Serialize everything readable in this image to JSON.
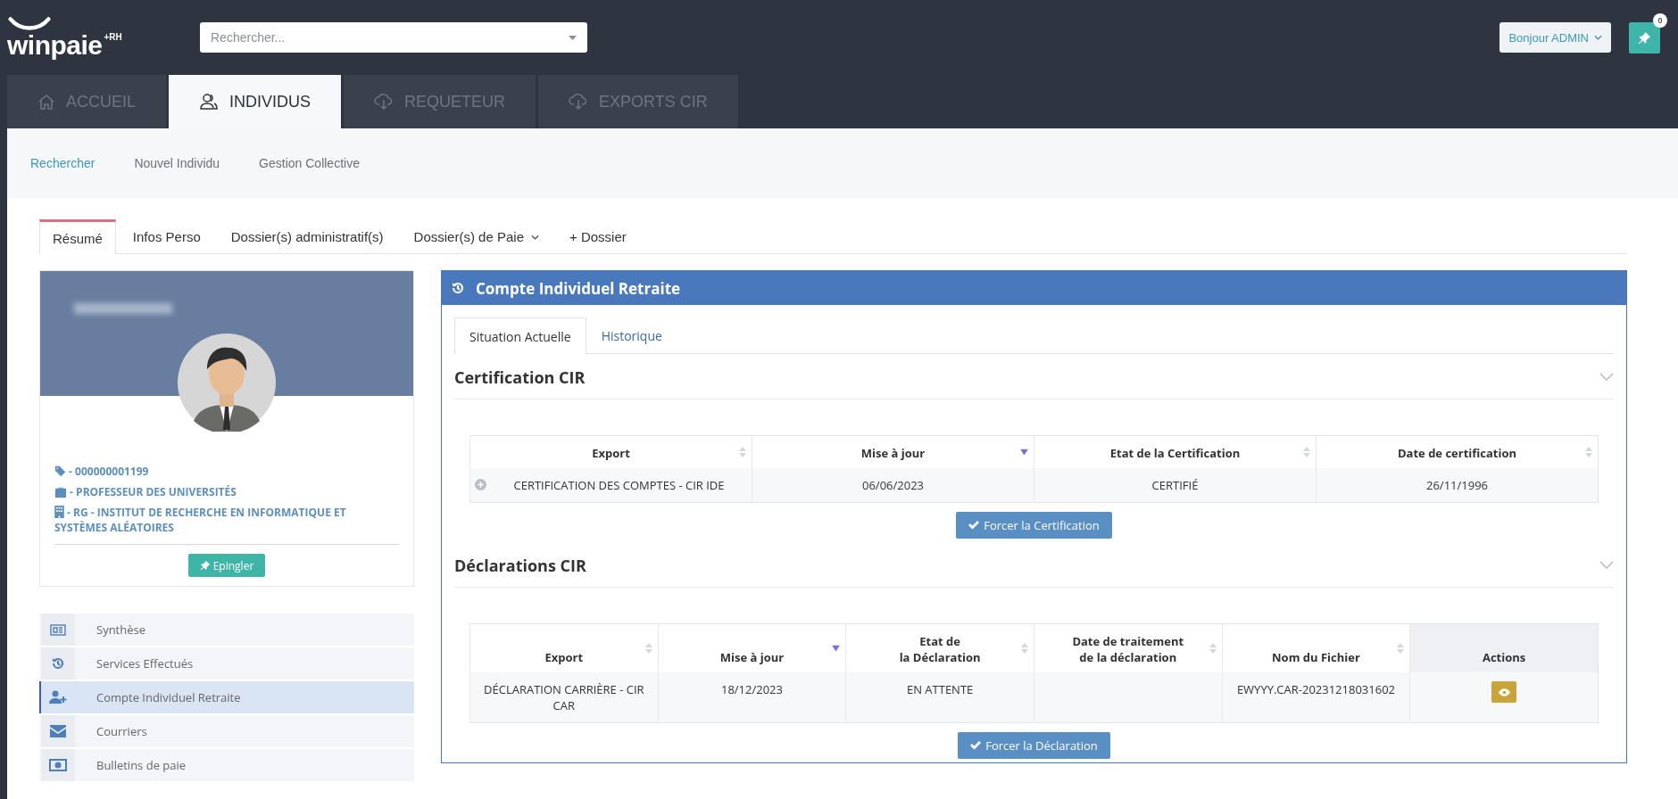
{
  "header": {
    "logo": "winpaie",
    "logo_suffix": "+RH",
    "search": {
      "placeholder": "Rechercher..."
    },
    "user_menu": "Bonjour ADMIN",
    "pin_count": "0"
  },
  "main_tabs": [
    {
      "label": "ACCUEIL",
      "selected": false
    },
    {
      "label": "INDIVIDUS",
      "selected": true
    },
    {
      "label": "REQUETEUR",
      "selected": false
    },
    {
      "label": "EXPORTS CIR",
      "selected": false
    }
  ],
  "sub_nav": [
    {
      "label": "Rechercher",
      "selected": true
    },
    {
      "label": "Nouvel Individu",
      "selected": false
    },
    {
      "label": "Gestion Collective",
      "selected": false
    }
  ],
  "content_tabs": [
    {
      "label": "Résumé",
      "selected": true,
      "dropdown": false
    },
    {
      "label": "Infos Perso",
      "selected": false,
      "dropdown": false
    },
    {
      "label": "Dossier(s) administratif(s)",
      "selected": false,
      "dropdown": false
    },
    {
      "label": "Dossier(s) de Paie",
      "selected": false,
      "dropdown": true
    },
    {
      "label": "+ Dossier",
      "selected": false,
      "dropdown": false
    }
  ],
  "profile": {
    "info": [
      "- 000000001199",
      "- PROFESSEUR DES UNIVERSITÉS",
      "- RG - INSTITUT DE RECHERCHE EN INFORMATIQUE ET SYSTÈMES ALÉATOIRES"
    ],
    "pin_button": "Epingler"
  },
  "side_menu": [
    {
      "label": "Synthèse",
      "selected": false
    },
    {
      "label": "Services Effectués",
      "selected": false
    },
    {
      "label": "Compte Individuel Retraite",
      "selected": true
    },
    {
      "label": "Courriers",
      "selected": false
    },
    {
      "label": "Bulletins de paie",
      "selected": false
    }
  ],
  "panel": {
    "title": "Compte Individuel Retraite",
    "tabs": [
      {
        "label": "Situation Actuelle",
        "selected": true
      },
      {
        "label": "Historique",
        "selected": false
      }
    ],
    "sections": [
      {
        "title": "Certification CIR",
        "columns": [
          {
            "label": "Export",
            "sortable": true,
            "sorted": false
          },
          {
            "label": "Mise à jour",
            "sortable": true,
            "sorted": true
          },
          {
            "label": "Etat de la Certification",
            "sortable": true,
            "sorted": false
          },
          {
            "label": "Date de certification",
            "sortable": true,
            "sorted": false
          }
        ],
        "rows": [
          {
            "expandable": true,
            "cells": [
              "CERTIFICATION DES COMPTES - CIR IDE",
              "06/06/2023",
              "CERTIFIÉ",
              "26/11/1996"
            ],
            "action": false
          }
        ],
        "button": "Forcer la Certification"
      },
      {
        "title": "Déclarations CIR",
        "columns": [
          {
            "label": "Export",
            "sortable": true,
            "sorted": false
          },
          {
            "label": "Mise à jour",
            "sortable": true,
            "sorted": true
          },
          {
            "label": "Etat de\nla Déclaration",
            "sortable": true,
            "sorted": false
          },
          {
            "label": "Date de traitement\nde la déclaration",
            "sortable": true,
            "sorted": false
          },
          {
            "label": "Nom du Fichier",
            "sortable": true,
            "sorted": false
          },
          {
            "label": "Actions",
            "sortable": false
          }
        ],
        "rows": [
          {
            "expandable": false,
            "cells": [
              "DÉCLARATION CARRIÈRE - CIR CAR",
              "18/12/2023",
              "EN ATTENTE",
              "",
              "EWYYY.CAR-20231218031602"
            ],
            "action": true
          }
        ],
        "button": "Forcer la Déclaration"
      }
    ]
  }
}
